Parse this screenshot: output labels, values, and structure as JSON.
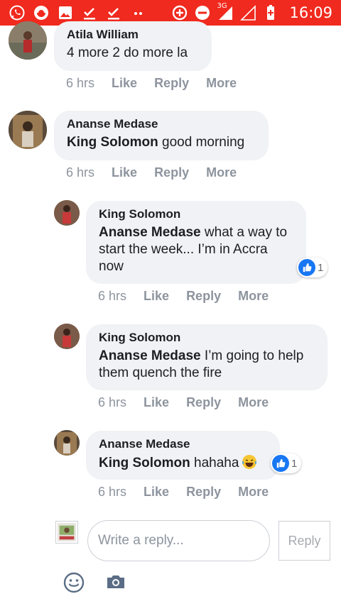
{
  "status_bar": {
    "time": "16:09",
    "network": "3G"
  },
  "comments": [
    {
      "author": "Atila William",
      "mention": "",
      "text": "4 more 2 do more la",
      "time": "6 hrs",
      "like": "Like",
      "reply": "Reply",
      "more": "More"
    },
    {
      "author": "Ananse Medase",
      "mention": "King Solomon",
      "text": " good morning",
      "time": "6 hrs",
      "like": "Like",
      "reply": "Reply",
      "more": "More"
    },
    {
      "author": "King Solomon",
      "mention": "Ananse Medase",
      "text": " what a way to start the week... I’m in Accra now",
      "time": "6 hrs",
      "like": "Like",
      "reply": "Reply",
      "more": "More",
      "reaction_count": "1"
    },
    {
      "author": "King Solomon",
      "mention": "Ananse Medase",
      "text": " I’m going to help them quench the fire",
      "time": "6 hrs",
      "like": "Like",
      "reply": "Reply",
      "more": "More"
    },
    {
      "author": "Ananse Medase",
      "mention": "King Solomon",
      "text": " hahaha",
      "time": "6 hrs",
      "like": "Like",
      "reply": "Reply",
      "more": "More",
      "reaction_count": "1"
    }
  ],
  "composer": {
    "placeholder": "Write a reply...",
    "reply_button": "Reply"
  },
  "colors": {
    "status_bar": "#f02a1e",
    "bubble": "#f0f2f5",
    "like_blue": "#1877f2",
    "meta_gray": "#8d949e"
  },
  "icons": [
    "whatsapp-icon",
    "opera-icon",
    "gallery-icon",
    "download-done-icon",
    "more-dots-icon",
    "data-saver-icon",
    "do-not-disturb-icon",
    "signal-icon",
    "battery-icon",
    "like-icon",
    "laughing-emoji-icon",
    "emoji-icon",
    "camera-icon"
  ]
}
